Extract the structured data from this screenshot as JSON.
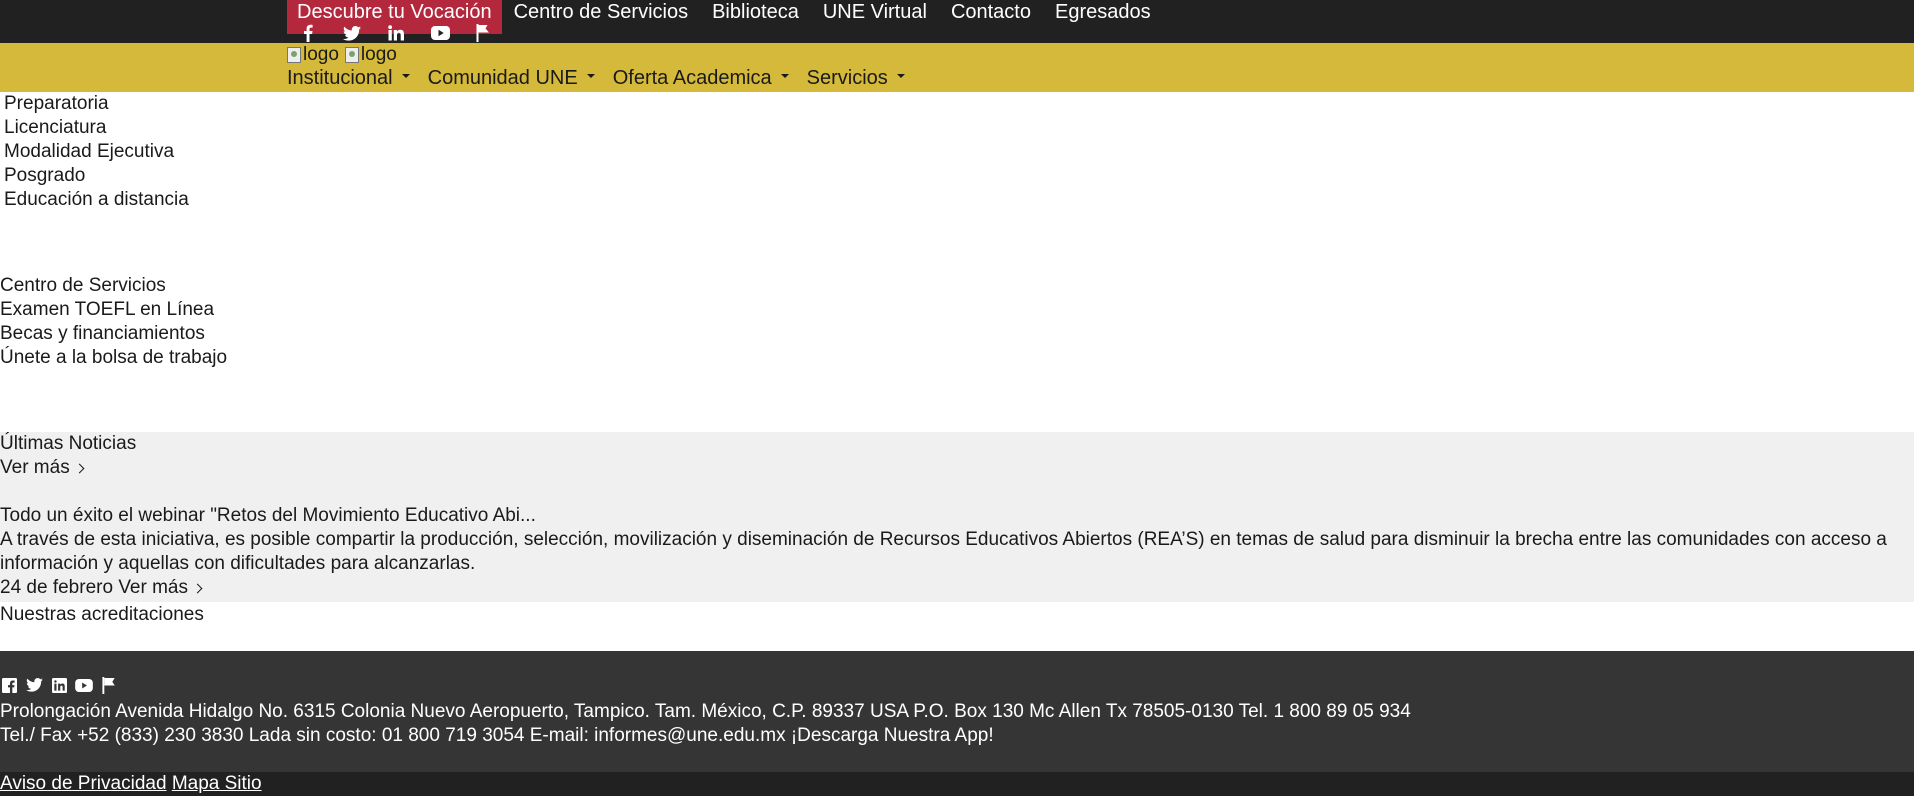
{
  "topbar": {
    "items": [
      "Descubre tu Vocación",
      "Centro de Servicios",
      "Biblioteca",
      "UNE Virtual",
      "Contacto",
      "Egresados"
    ],
    "accent": "#b3283d",
    "social_icons": [
      "facebook-icon",
      "twitter-icon",
      "linkedin-icon",
      "youtube-icon",
      "flag-icon"
    ]
  },
  "header": {
    "logo_alt_1": "logo",
    "logo_alt_2": "logo",
    "nav": [
      "Institucional",
      "Comunidad UNE",
      "Oferta Academica",
      "Servicios"
    ],
    "background": "#d4b93a"
  },
  "offer_list": [
    "Preparatoria",
    "Licenciatura",
    "Modalidad Ejecutiva",
    "Posgrado",
    "Educación a distancia"
  ],
  "services_list": [
    "Centro de Servicios",
    "Examen TOEFL en Línea",
    "Becas y financiamientos",
    "Únete a la bolsa de trabajo"
  ],
  "news": {
    "title": "Últimas Noticias",
    "see_more": "Ver más",
    "item_title": "Todo un éxito el webinar \"Retos del Movimiento Educativo Abi...",
    "item_body": "A través de esta iniciativa, es posible compartir la producción, selección, movilización y diseminación de Recursos Educativos Abiertos (REA’S) en temas de salud para disminuir la brecha entre las comunidades con acceso a información y aquellas con dificultades para alcanzarlas.",
    "item_date": "24 de febrero",
    "item_more": "Ver más"
  },
  "accreditations_title": "Nuestras acreditaciones",
  "footer": {
    "social_icons": [
      "facebook-icon",
      "twitter-icon",
      "linkedin-icon",
      "youtube-icon",
      "flag-icon"
    ],
    "address_line1": "Prolongación Avenida Hidalgo No. 6315 Colonia Nuevo Aeropuerto, Tampico. Tam. México, C.P. 89337 USA P.O. Box 130 Mc Allen Tx 78505-0130 Tel. 1 800 89 05 934",
    "address_line2": "Tel./ Fax +52 (833) 230 3830 Lada sin costo: 01 800 719 3054 E-mail: informes@une.edu.mx ¡Descarga Nuestra App!",
    "privacy": "Aviso de Privacidad",
    "sitemap": "Mapa Sitio"
  }
}
